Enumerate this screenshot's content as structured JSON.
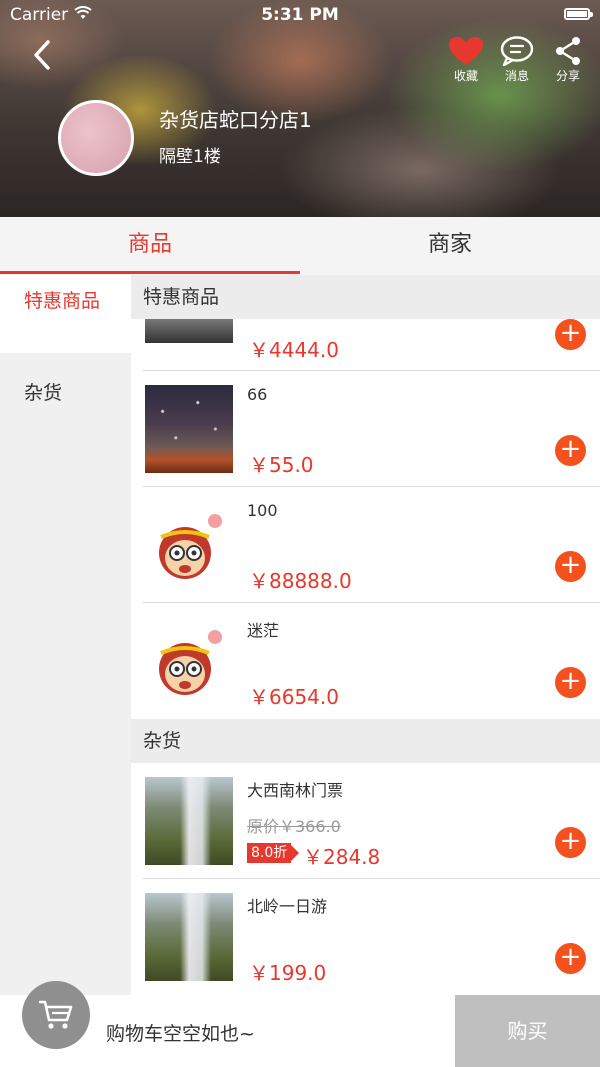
{
  "status_bar": {
    "carrier": "Carrier",
    "time": "5:31 PM"
  },
  "header": {
    "shop_name": "杂货店蛇口分店1",
    "address": "隔壁1楼",
    "actions": [
      {
        "label": "收藏",
        "icon": "heart-icon"
      },
      {
        "label": "消息",
        "icon": "message-icon"
      },
      {
        "label": "分享",
        "icon": "share-icon"
      }
    ],
    "colors": {
      "favorite": "#e6382e"
    }
  },
  "tabs": [
    {
      "label": "商品",
      "active": true
    },
    {
      "label": "商家",
      "active": false
    }
  ],
  "sidebar": {
    "categories": [
      {
        "label": "特惠商品",
        "active": true
      },
      {
        "label": "杂货",
        "active": false
      }
    ]
  },
  "sections": [
    {
      "title": "特惠商品",
      "items": [
        {
          "name": "",
          "price": "￥4444.0",
          "image": "screen"
        },
        {
          "name": "66",
          "price": "￥55.0",
          "image": "night-sky"
        },
        {
          "name": "100",
          "price": "￥88888.0",
          "image": "monkey"
        },
        {
          "name": "迷茫",
          "price": "￥6654.0",
          "image": "monkey"
        }
      ]
    },
    {
      "title": "杂货",
      "items": [
        {
          "name": "大西南林门票",
          "original_price": "原价￥366.0",
          "discount": "8.0折",
          "price": "￥284.8",
          "image": "waterfall"
        },
        {
          "name": "北岭一日游",
          "price": "￥199.0",
          "image": "waterfall"
        }
      ]
    }
  ],
  "cart": {
    "empty_text": "购物车空空如也~",
    "buy_label": "购买"
  },
  "colors": {
    "accent": "#e6382e",
    "add_button": "#f4511e",
    "buy_disabled": "#bfbfbf"
  }
}
